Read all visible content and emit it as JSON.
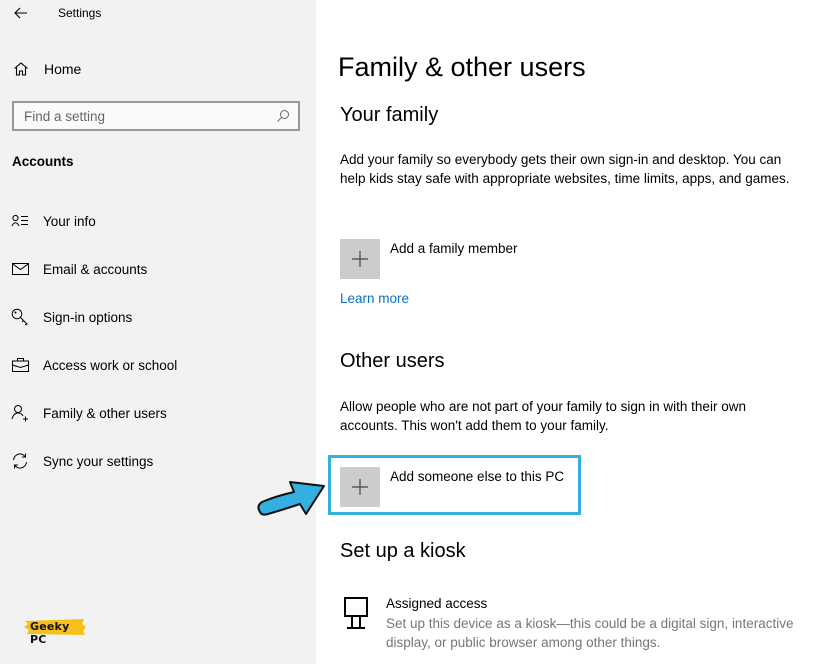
{
  "window": {
    "title": "Settings",
    "back_icon": "arrow-left-icon"
  },
  "sidebar": {
    "home": {
      "label": "Home",
      "icon": "home-icon"
    },
    "search": {
      "placeholder": "Find a setting",
      "value": "",
      "icon": "search-icon"
    },
    "section_label": "Accounts",
    "items": [
      {
        "label": "Your info",
        "icon": "person-list-icon"
      },
      {
        "label": "Email & accounts",
        "icon": "mail-icon"
      },
      {
        "label": "Sign-in options",
        "icon": "key-icon"
      },
      {
        "label": "Access work or school",
        "icon": "briefcase-icon"
      },
      {
        "label": "Family & other users",
        "icon": "person-add-icon",
        "selected": true
      },
      {
        "label": "Sync your settings",
        "icon": "sync-icon"
      }
    ],
    "watermark": "Geeky PC"
  },
  "main": {
    "page_title": "Family & other users",
    "your_family": {
      "heading": "Your family",
      "description": "Add your family so everybody gets their own sign-in and desktop. You can help kids stay safe with appropriate websites, time limits, apps, and games.",
      "add_label": "Add a family member",
      "learn_more": "Learn more"
    },
    "other_users": {
      "heading": "Other users",
      "description": "Allow people who are not part of your family to sign in with their own accounts. This won't add them to your family.",
      "add_label": "Add someone else to this PC"
    },
    "kiosk": {
      "heading": "Set up a kiosk",
      "title": "Assigned access",
      "description": "Set up this device as a kiosk—this could be a digital sign, interactive display, or public browser among other things."
    }
  },
  "colors": {
    "sidebar_bg": "#f2f2f2",
    "link": "#0a70c9",
    "highlight": "#33b0e0",
    "arrow": "#33b0e0",
    "tile": "#cccccc",
    "watermark_bg": "#f5c01a"
  }
}
